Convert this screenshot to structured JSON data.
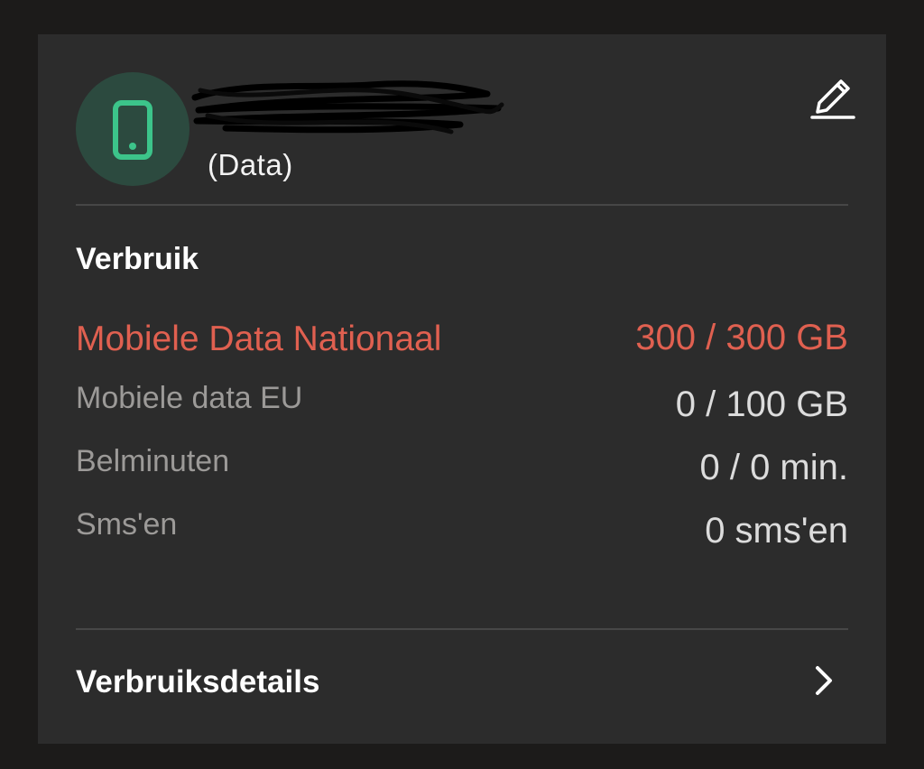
{
  "line": {
    "icon": "smartphone-icon",
    "type_label": "(Data)"
  },
  "actions": {
    "edit_icon": "pencil-icon"
  },
  "usage": {
    "title": "Verbruik",
    "rows": [
      {
        "label": "Mobiele Data Nationaal",
        "value": "300 / 300 GB",
        "status": "exceeded"
      },
      {
        "label": "Mobiele data EU",
        "value": "0 / 100 GB",
        "status": "normal"
      },
      {
        "label": "Belminuten",
        "value": "0 / 0 min.",
        "status": "normal"
      },
      {
        "label": "Sms'en",
        "value": "0 sms'en",
        "status": "normal"
      }
    ]
  },
  "details": {
    "label": "Verbruiksdetails",
    "icon": "chevron-right-icon"
  },
  "colors": {
    "background": "#1c1b1a",
    "card": "#2c2c2c",
    "accent_green": "#3cc48a",
    "alert_red": "#e06050",
    "muted_text": "#9c9a98"
  }
}
